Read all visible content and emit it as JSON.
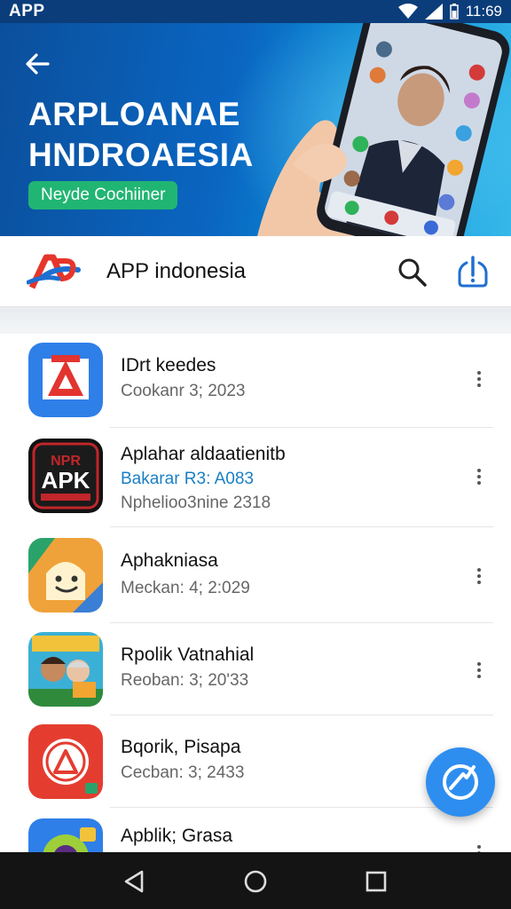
{
  "status_bar": {
    "carrier": "APP",
    "time": "11:69"
  },
  "banner": {
    "title_line1": "ARPLOANAE",
    "title_line2": "HNDROAESIA",
    "pill_label": "Neyde Cochiiner"
  },
  "header": {
    "app_name": "APP indonesia"
  },
  "apps": [
    {
      "title": "IDrt keedes",
      "line2": "Cookanr 3; 2023",
      "line3": ""
    },
    {
      "title": "Aplahar aldaatienitb",
      "line2": "Bakarar R3: A083",
      "line3": "Nphelioo3nine 2318"
    },
    {
      "title": "Aphakniasa",
      "line2": "Meckan: 4; 2:029",
      "line3": ""
    },
    {
      "title": "Rpolik Vatnahial",
      "line2": "Reoban: 3; 20'33",
      "line3": ""
    },
    {
      "title": "Bqorik, Pisapa",
      "line2": "Cecban: 3; 2433",
      "line3": ""
    },
    {
      "title": "Apblik; Grasa",
      "line2": "",
      "line3": ""
    }
  ],
  "icon_texts": {
    "apk": "APK",
    "apk_top": "NPR"
  },
  "colors": {
    "status_bar": "#0a3d7a",
    "banner_start": "#0b4f9c",
    "banner_end": "#36b8ea",
    "pill": "#21b573",
    "accent_blue": "#1a7fc4",
    "fab": "#2d8ef0",
    "logo_red": "#e6352b",
    "logo_blue": "#1f6fd1"
  },
  "icons": {
    "back": "arrow-left-icon",
    "search": "search-icon",
    "update": "update-alert-icon",
    "more": "more-vertical-icon",
    "fab": "share-icon",
    "nav_back": "triangle-back-icon",
    "nav_home": "circle-home-icon",
    "nav_recent": "square-recent-icon"
  }
}
